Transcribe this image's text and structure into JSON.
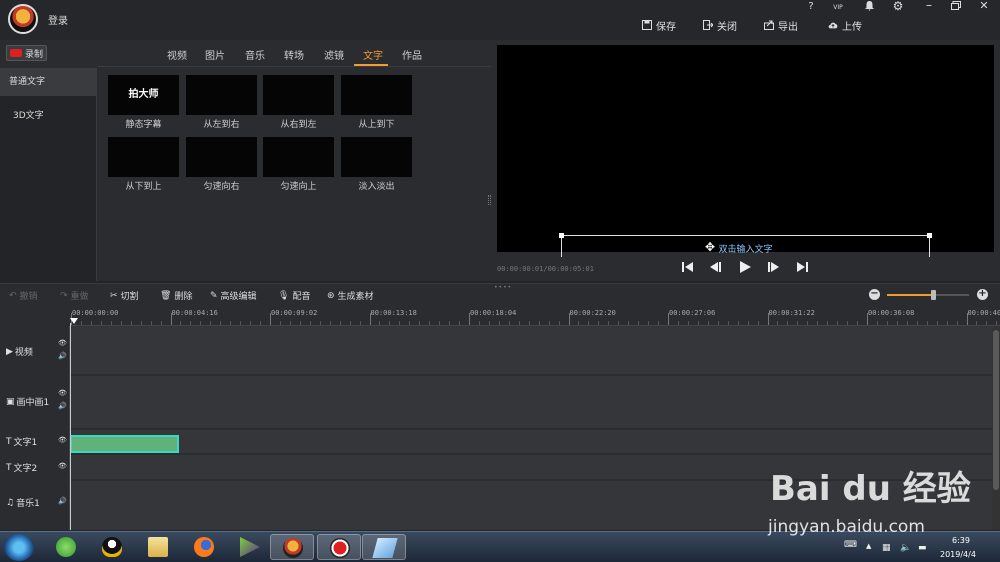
{
  "titlebar": {
    "login": "登录",
    "help": "?",
    "vip": "VIP",
    "save": "保存",
    "close": "关闭",
    "export": "导出",
    "upload": "上传"
  },
  "left": {
    "record": "录制",
    "tabs": [
      "视频",
      "图片",
      "音乐",
      "转场",
      "滤镜",
      "文字",
      "作品"
    ],
    "active_tab": "文字",
    "categories": [
      "普通文字",
      "3D文字"
    ],
    "thumbs": [
      {
        "preview": "拍大师",
        "label": "静态字幕"
      },
      {
        "preview": "",
        "label": "从左到右"
      },
      {
        "preview": "",
        "label": "从右到左"
      },
      {
        "preview": "",
        "label": "从上到下"
      },
      {
        "preview": "",
        "label": "从下到上"
      },
      {
        "preview": "",
        "label": "匀速向右"
      },
      {
        "preview": "",
        "label": "匀速向上"
      },
      {
        "preview": "",
        "label": "淡入淡出"
      }
    ]
  },
  "preview": {
    "text_prompt": "双击输入文字",
    "timecode": "00:00:00:01/00:00:05:01"
  },
  "toolbar": {
    "undo": "撤销",
    "redo": "重做",
    "cut": "切割",
    "delete": "删除",
    "advanced": "高级编辑",
    "dub": "配音",
    "generate": "生成素材",
    "zoom_level": 0.56
  },
  "timeline": {
    "ticks": [
      "00:00:00:00",
      "00:00:04:16",
      "00:00:09:02",
      "00:00:13:18",
      "00:00:18:04",
      "00:00:22:20",
      "00:00:27:06",
      "00:00:31:22",
      "00:00:36:08",
      "00:00:40:"
    ],
    "tracks": [
      "视频",
      "画中画1",
      "文字1",
      "文字2",
      "音乐1"
    ]
  },
  "taskbar": {
    "time": "6:39",
    "date": "2019/4/4"
  },
  "watermark": {
    "brand": "Bai du 经验",
    "url": "jingyan.baidu.com"
  },
  "colors": {
    "accent": "#f39a32",
    "clip": "#5fb37a",
    "clip_border": "#3ad7c4"
  }
}
